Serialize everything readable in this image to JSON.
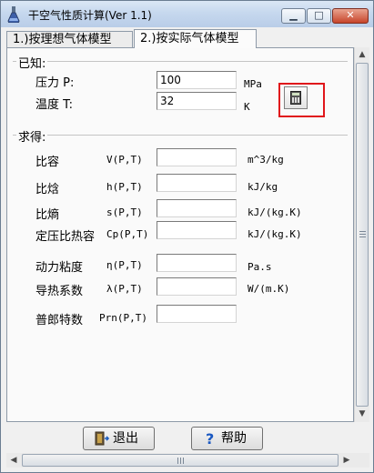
{
  "window": {
    "title": "干空气性质计算(Ver 1.1)",
    "app_icon": "flask-icon",
    "controls": {
      "minimize": "▁",
      "maximize": "□",
      "close": "✕"
    }
  },
  "tabs": [
    {
      "label": "1.)按理想气体模型",
      "selected": false
    },
    {
      "label": "2.)按实际气体模型",
      "selected": true
    }
  ],
  "known": {
    "group_label": "已知:",
    "pressure": {
      "label": "压力 P:",
      "value": "100",
      "unit": "MPa"
    },
    "temperature": {
      "label": "温度 T:",
      "value": "32",
      "unit": "K"
    },
    "calculator_button_icon": "calculator-icon"
  },
  "results": {
    "group_label": "求得:",
    "rows": [
      {
        "label": "比容",
        "symbol": "V(P,T)",
        "value": "",
        "unit": "m^3/kg"
      },
      {
        "label": "比焓",
        "symbol": "h(P,T)",
        "value": "",
        "unit": "kJ/kg"
      },
      {
        "label": "比熵",
        "symbol": "s(P,T)",
        "value": "",
        "unit": "kJ/(kg.K)"
      },
      {
        "label": "定压比热容",
        "symbol": "Cp(P,T)",
        "value": "",
        "unit": "kJ/(kg.K)"
      },
      {
        "label": "动力粘度",
        "symbol": "η(P,T)",
        "value": "",
        "unit": "Pa.s"
      },
      {
        "label": "导热系数",
        "symbol": "λ(P,T)",
        "value": "",
        "unit": "W/(m.K)"
      },
      {
        "label": "普郎特数",
        "symbol": "Prn(P,T)",
        "value": "",
        "unit": ""
      }
    ]
  },
  "buttons": {
    "exit": {
      "label": "退出",
      "icon": "exit-door-icon"
    },
    "help": {
      "label": "帮助",
      "icon": "help-question-icon"
    }
  },
  "colors": {
    "highlight_box": "#e0161b",
    "titlebar": "#c6d8ee"
  }
}
